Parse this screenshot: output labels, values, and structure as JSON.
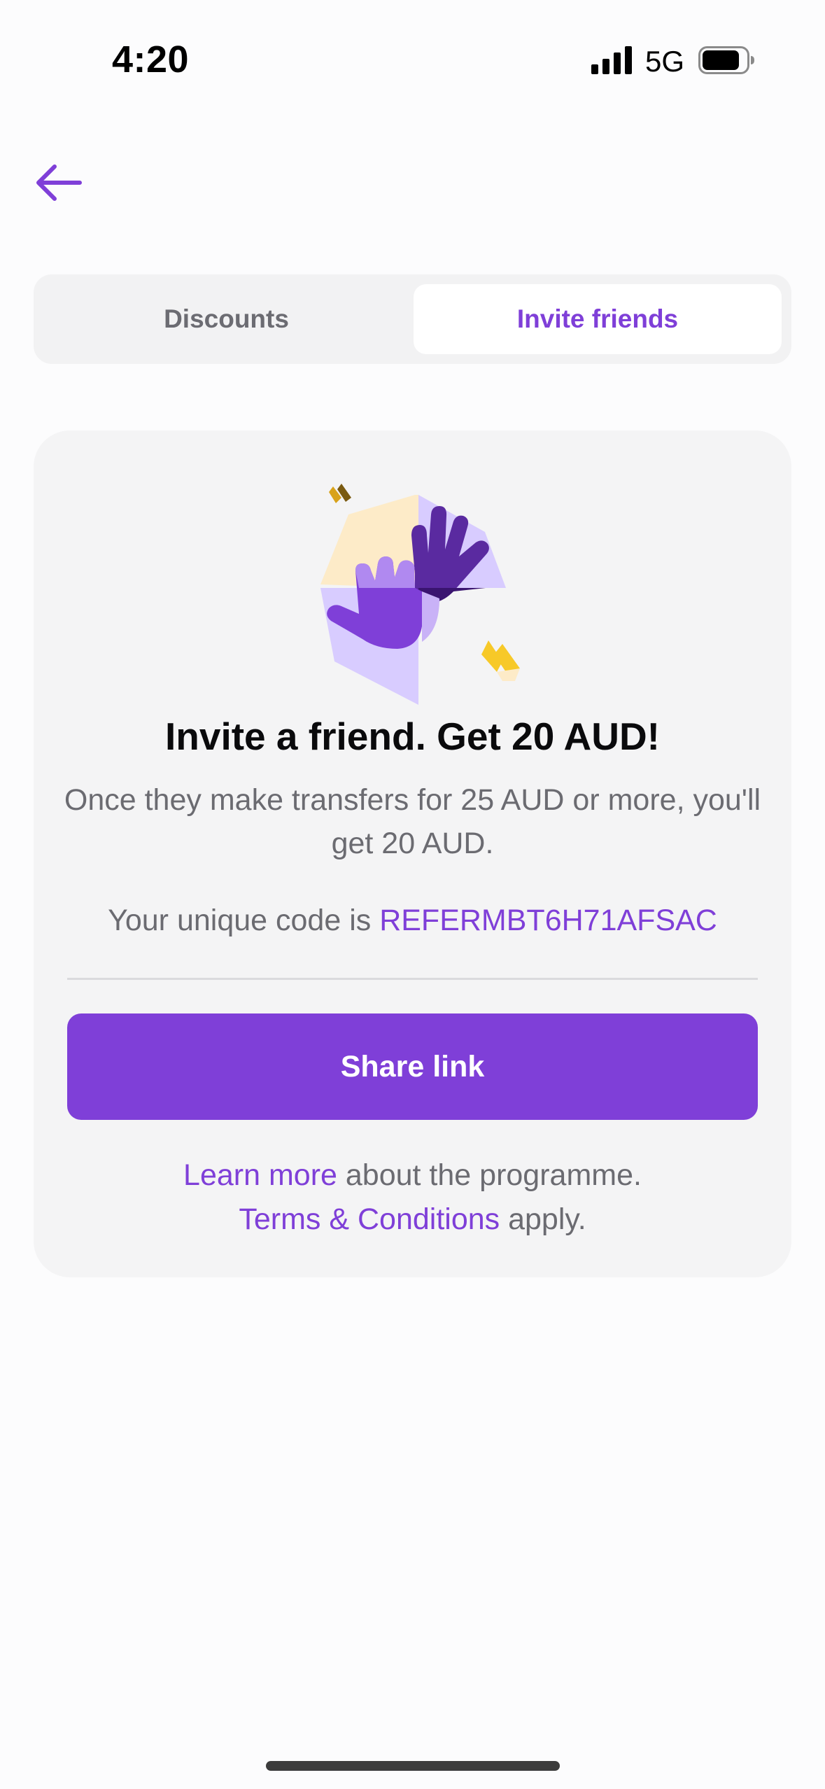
{
  "status_bar": {
    "time": "4:20",
    "network": "5G"
  },
  "header": {
    "back_icon": "arrow-left-icon"
  },
  "tabs": [
    {
      "label": "Discounts",
      "selected": false
    },
    {
      "label": "Invite friends",
      "selected": true
    }
  ],
  "invite": {
    "illustration": "high-five-hands-illustration",
    "headline": "Invite a friend. Get 20 AUD!",
    "subtext": "Once they make transfers for 25 AUD or more, you'll get 20 AUD.",
    "code_prefix": "Your unique code is ",
    "code": "REFERMBT6H71AFSAC",
    "share_label": "Share link",
    "learn_more_link": "Learn more",
    "learn_more_rest": " about the programme.",
    "terms_link": "Terms & Conditions",
    "terms_rest": " apply."
  },
  "colors": {
    "accent": "#7f3fd8",
    "card_bg": "#f4f4f5",
    "muted_text": "#6b6b71"
  }
}
